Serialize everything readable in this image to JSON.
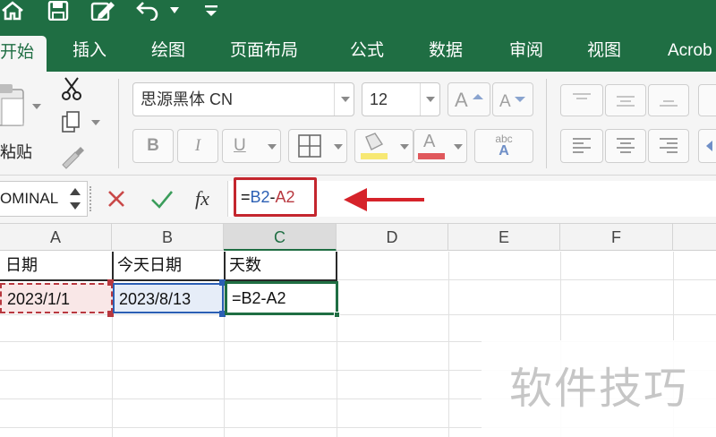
{
  "tabs": [
    "开始",
    "插入",
    "绘图",
    "页面布局",
    "公式",
    "数据",
    "审阅",
    "视图",
    "Acrob"
  ],
  "ribbon": {
    "paste_label": "粘贴",
    "font_name": "思源黑体 CN",
    "font_size": "12",
    "bold": "B",
    "italic": "I",
    "underline": "U",
    "font_color_glyph": "A",
    "fill_color": "#f7e873",
    "font_color": "#e0585c",
    "wrap_glyph": "abc"
  },
  "formula_bar": {
    "name_box": "OMINAL",
    "fx": "fx",
    "formula_prefix": "=",
    "formula_ref1": "B2",
    "formula_op": "-",
    "formula_ref2": "A2",
    "ref1_color": "#2b5fb4",
    "ref2_color": "#b8383f"
  },
  "columns": [
    "A",
    "B",
    "C",
    "D",
    "E",
    "F"
  ],
  "rows": [
    [
      "日期",
      "今天日期",
      "天数"
    ],
    [
      "2023/1/1",
      "2023/8/13",
      "=B2-A2"
    ]
  ],
  "watermark": "软件技巧",
  "colors": {
    "accent": "#1f6e43",
    "highlight_box": "#c4262e"
  }
}
